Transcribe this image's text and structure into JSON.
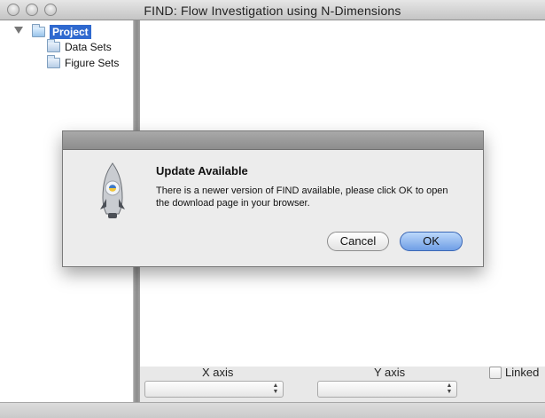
{
  "window": {
    "title": "FIND: Flow Investigation using N-Dimensions"
  },
  "sidebar": {
    "root": "Project",
    "items": [
      {
        "label": "Data Sets"
      },
      {
        "label": "Figure Sets"
      }
    ]
  },
  "dialog": {
    "title": "Update Available",
    "message": "There is a newer version of FIND available, please click OK to open the download page in your browser.",
    "buttons": {
      "cancel": "Cancel",
      "ok": "OK"
    },
    "icon": "rocket-icon"
  },
  "controls": {
    "x_axis_label": "X axis",
    "y_axis_label": "Y axis",
    "linked_label": "Linked",
    "x_axis_value": "",
    "y_axis_value": ""
  },
  "colors": {
    "selection": "#2f69cf",
    "ok_button": "#6f9ee5"
  }
}
